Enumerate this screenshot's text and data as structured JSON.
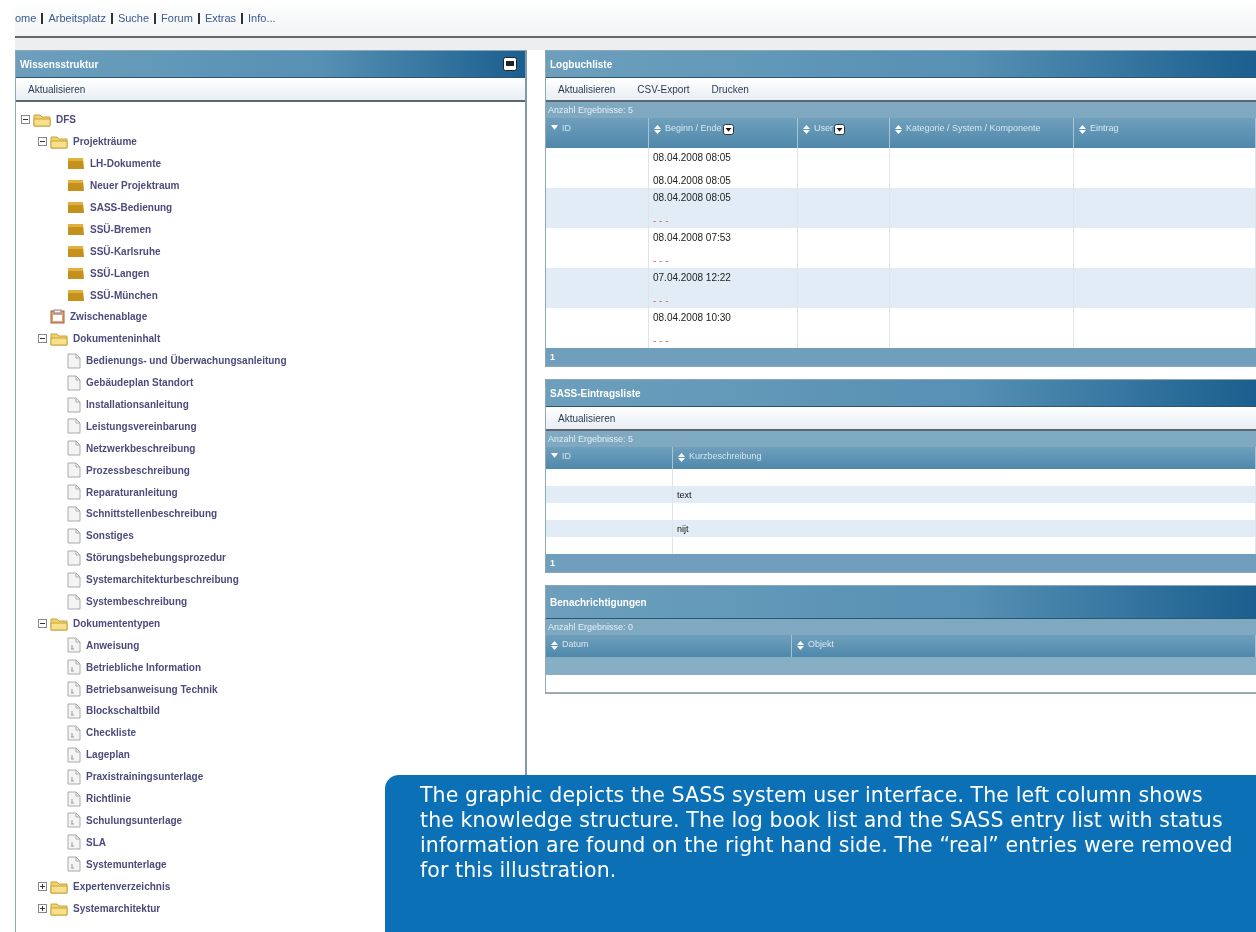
{
  "nav_links": [
    "ome",
    "Arbeitsplatz",
    "Suche",
    "Forum",
    "Extras",
    "Info..."
  ],
  "knowledge_panel": {
    "title": "Wissensstruktur",
    "toolbar": [
      "Aktualisieren"
    ],
    "tree": [
      {
        "label": "DFS",
        "kind": "folder",
        "expanded": true,
        "children": [
          {
            "label": "Projekträume",
            "kind": "folder",
            "expanded": true,
            "children": [
              {
                "label": "LH-Dokumente",
                "kind": "room"
              },
              {
                "label": "Neuer Projektraum",
                "kind": "room"
              },
              {
                "label": "SASS-Bedienung",
                "kind": "room"
              },
              {
                "label": "SSÜ-Bremen",
                "kind": "room"
              },
              {
                "label": "SSÜ-Karlsruhe",
                "kind": "room"
              },
              {
                "label": "SSÜ-Langen",
                "kind": "room"
              },
              {
                "label": "SSÜ-München",
                "kind": "room"
              }
            ]
          },
          {
            "label": "Zwischenablage",
            "kind": "clipboard"
          },
          {
            "label": "Dokumenteninhalt",
            "kind": "folder",
            "expanded": true,
            "children": [
              {
                "label": "Bedienungs- und Überwachungsanleitung",
                "kind": "document"
              },
              {
                "label": "Gebäudeplan Standort",
                "kind": "document"
              },
              {
                "label": "Installationsanleitung",
                "kind": "document"
              },
              {
                "label": "Leistungsvereinbarung",
                "kind": "document"
              },
              {
                "label": "Netzwerkbeschreibung",
                "kind": "document"
              },
              {
                "label": "Prozessbeschreibung",
                "kind": "document"
              },
              {
                "label": "Reparaturanleitung",
                "kind": "document"
              },
              {
                "label": "Schnittstellenbeschreibung",
                "kind": "document"
              },
              {
                "label": "Sonstiges",
                "kind": "document"
              },
              {
                "label": "Störungsbehebungsprozedur",
                "kind": "document"
              },
              {
                "label": "Systemarchitekturbeschreibung",
                "kind": "document"
              },
              {
                "label": "Systembeschreibung",
                "kind": "document"
              }
            ]
          },
          {
            "label": "Dokumententypen",
            "kind": "folder",
            "expanded": true,
            "children": [
              {
                "label": "Anweisung",
                "kind": "doctype"
              },
              {
                "label": "Betriebliche Information",
                "kind": "doctype"
              },
              {
                "label": "Betriebsanweisung Technik",
                "kind": "doctype"
              },
              {
                "label": "Blockschaltbild",
                "kind": "doctype"
              },
              {
                "label": "Checkliste",
                "kind": "doctype"
              },
              {
                "label": "Lageplan",
                "kind": "doctype"
              },
              {
                "label": "Praxistrainingsunterlage",
                "kind": "doctype"
              },
              {
                "label": "Richtlinie",
                "kind": "doctype"
              },
              {
                "label": "Schulungsunterlage",
                "kind": "doctype"
              },
              {
                "label": "SLA",
                "kind": "doctype"
              },
              {
                "label": "Systemunterlage",
                "kind": "doctype"
              }
            ]
          },
          {
            "label": "Expertenverzeichnis",
            "kind": "folder",
            "expanded": false
          },
          {
            "label": "Systemarchitektur",
            "kind": "folder",
            "expanded": false
          }
        ]
      }
    ]
  },
  "logbook": {
    "title": "Logbuchliste",
    "toolbar": [
      "Aktualisieren",
      "CSV-Export",
      "Drucken"
    ],
    "count": "Anzahl Ergebnisse: 5",
    "columns": [
      {
        "label": "ID",
        "sorted": true,
        "filter": false
      },
      {
        "label": "Beginn / Ende",
        "sorted": false,
        "filter": true
      },
      {
        "label": "User",
        "sorted": false,
        "filter": true
      },
      {
        "label": "Kategorie / System / Komponente",
        "sorted": false,
        "filter": false
      },
      {
        "label": "Eintrag",
        "sorted": false,
        "filter": false
      }
    ],
    "rows": [
      {
        "begin": "08.04.2008 08:05",
        "end": "08.04.2008 08:05",
        "end_open": false
      },
      {
        "begin": "08.04.2008 08:05",
        "end": "- - -",
        "end_open": true
      },
      {
        "begin": "08.04.2008 07:53",
        "end": "- - -",
        "end_open": true
      },
      {
        "begin": "07.04.2008 12:22",
        "end": "- - -",
        "end_open": true
      },
      {
        "begin": "08.04.2008 10:30",
        "end": "- - -",
        "end_open": true
      }
    ],
    "page": "1"
  },
  "sass_list": {
    "title": "SASS-Eintragsliste",
    "toolbar": [
      "Aktualisieren"
    ],
    "count": "Anzahl Ergebnisse: 5",
    "columns": [
      {
        "label": "ID",
        "sorted": true
      },
      {
        "label": "Kurzbeschreibung",
        "sorted": false
      }
    ],
    "rows": [
      {},
      {
        "summary": "text"
      },
      {},
      {
        "summary": "nijt"
      },
      {}
    ],
    "page": "1"
  },
  "notifications": {
    "title": "Benachrichtigungen",
    "count": "Anzahl Ergebnisse: 0",
    "columns": [
      {
        "label": "Datum",
        "sorted": false
      },
      {
        "label": "Objekt",
        "sorted": false
      }
    ]
  },
  "caption": "The graphic depicts the SASS system user interface. The left column shows the knowledge structure. The log book list and the SASS entry list with status information are found on the right hand side. The “real” entries were removed for this illustration."
}
